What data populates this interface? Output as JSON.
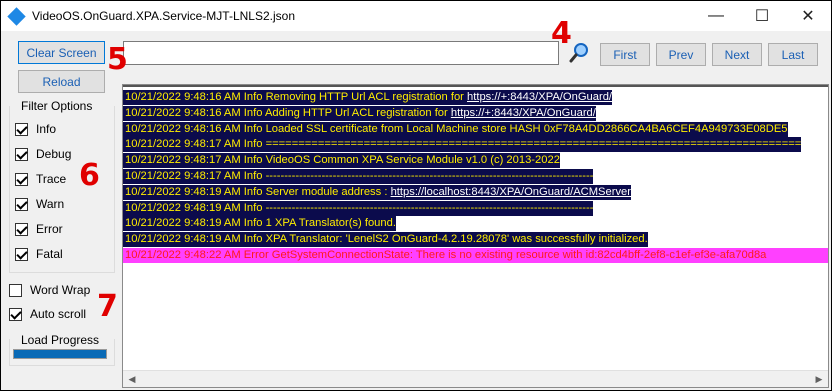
{
  "window": {
    "title": "VideoOS.OnGuard.XPA.Service-MJT-LNLS2.json",
    "minimize_glyph": "—",
    "maximize_glyph": "☐",
    "close_glyph": "✕"
  },
  "toolbar": {
    "clear_label": "Clear Screen",
    "reload_label": "Reload",
    "search_value": "",
    "first_label": "First",
    "prev_label": "Prev",
    "next_label": "Next",
    "last_label": "Last"
  },
  "annotations": [
    "4",
    "5",
    "6",
    "7"
  ],
  "filter": {
    "title": "Filter Options",
    "items": [
      {
        "label": "Info",
        "checked": true
      },
      {
        "label": "Debug",
        "checked": true
      },
      {
        "label": "Trace",
        "checked": true
      },
      {
        "label": "Warn",
        "checked": true
      },
      {
        "label": "Error",
        "checked": true
      },
      {
        "label": "Fatal",
        "checked": true
      }
    ]
  },
  "options": {
    "word_wrap": {
      "label": "Word Wrap",
      "checked": false
    },
    "auto_scroll": {
      "label": "Auto scroll",
      "checked": true
    }
  },
  "progress": {
    "title": "Load Progress",
    "value": 1.0
  },
  "log": {
    "lines": [
      {
        "level": "info",
        "text": "10/21/2022 9:48:16 AM Info Removing HTTP Url ACL registration for ",
        "link": "https://+:8443/XPA/OnGuard/"
      },
      {
        "level": "info",
        "text": "10/21/2022 9:48:16 AM Info Adding HTTP Url ACL registration for ",
        "link": "https://+:8443/XPA/OnGuard/"
      },
      {
        "level": "info",
        "text": "10/21/2022 9:48:16 AM Info Loaded SSL certificate from Local Machine store HASH 0xF78A4DD2866CA4BA6CEF4A949733E08DE5"
      },
      {
        "level": "info",
        "text": "10/21/2022 9:48:17 AM Info =================================================================================="
      },
      {
        "level": "info",
        "text": "10/21/2022 9:48:17 AM Info VideoOS Common XPA Service Module v1.0 (c) 2013-2022"
      },
      {
        "level": "info",
        "text": "10/21/2022 9:48:17 AM Info ----------------------------------------------------------------------------------------"
      },
      {
        "level": "info",
        "text": "10/21/2022 9:48:19 AM Info Server module address      : ",
        "link": "https://localhost:8443/XPA/OnGuard/ACMServer"
      },
      {
        "level": "info",
        "text": "10/21/2022 9:48:19 AM Info ----------------------------------------------------------------------------------------"
      },
      {
        "level": "info",
        "text": "10/21/2022 9:48:19 AM Info 1 XPA Translator(s) found."
      },
      {
        "level": "info",
        "text": "10/21/2022 9:48:19 AM Info XPA Translator: 'LenelS2 OnGuard-4.2.19.28078' was successfully initialized."
      },
      {
        "level": "error",
        "text": "10/21/2022 9:48:22 AM Error GetSystemConnectionState: There is no existing resource with id:82cd4bff-2ef8-c1ef-ef3e-afa70d8a"
      }
    ]
  },
  "colors": {
    "info_bg": "#0b0b4c",
    "info_fg": "#ffee00",
    "error_bg": "#ff40ff",
    "error_fg": "#ff1a1a",
    "annotation": "#e00000",
    "progress_fill": "#0a6ab6"
  },
  "icons": {
    "search": "magnifier-icon",
    "app": "diamond-app-icon"
  }
}
